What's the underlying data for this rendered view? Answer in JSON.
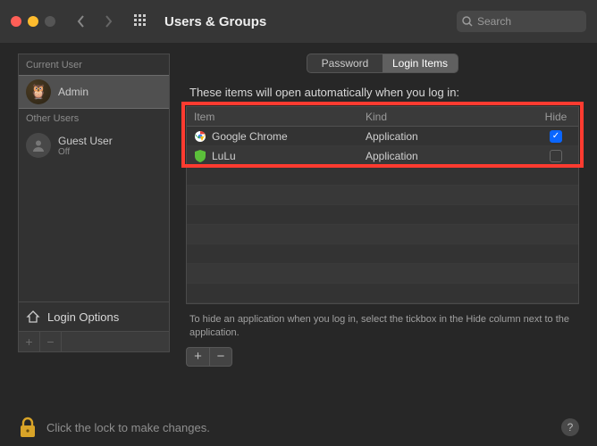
{
  "window": {
    "title": "Users & Groups",
    "search_placeholder": "Search"
  },
  "tabs": {
    "password": "Password",
    "login_items": "Login Items"
  },
  "sidebar": {
    "current_label": "Current User",
    "admin_name": "Admin",
    "other_label": "Other Users",
    "guest_name": "Guest User",
    "guest_sub": "Off",
    "login_options": "Login Options"
  },
  "main": {
    "caption": "These items will open automatically when you log in:",
    "columns": {
      "item": "Item",
      "kind": "Kind",
      "hide": "Hide"
    },
    "rows": [
      {
        "name": "Google Chrome",
        "kind": "Application",
        "hide": true
      },
      {
        "name": "LuLu",
        "kind": "Application",
        "hide": false
      }
    ],
    "hint": "To hide an application when you log in, select the tickbox in the Hide column next to the application."
  },
  "footer": {
    "lock_text": "Click the lock to make changes."
  }
}
